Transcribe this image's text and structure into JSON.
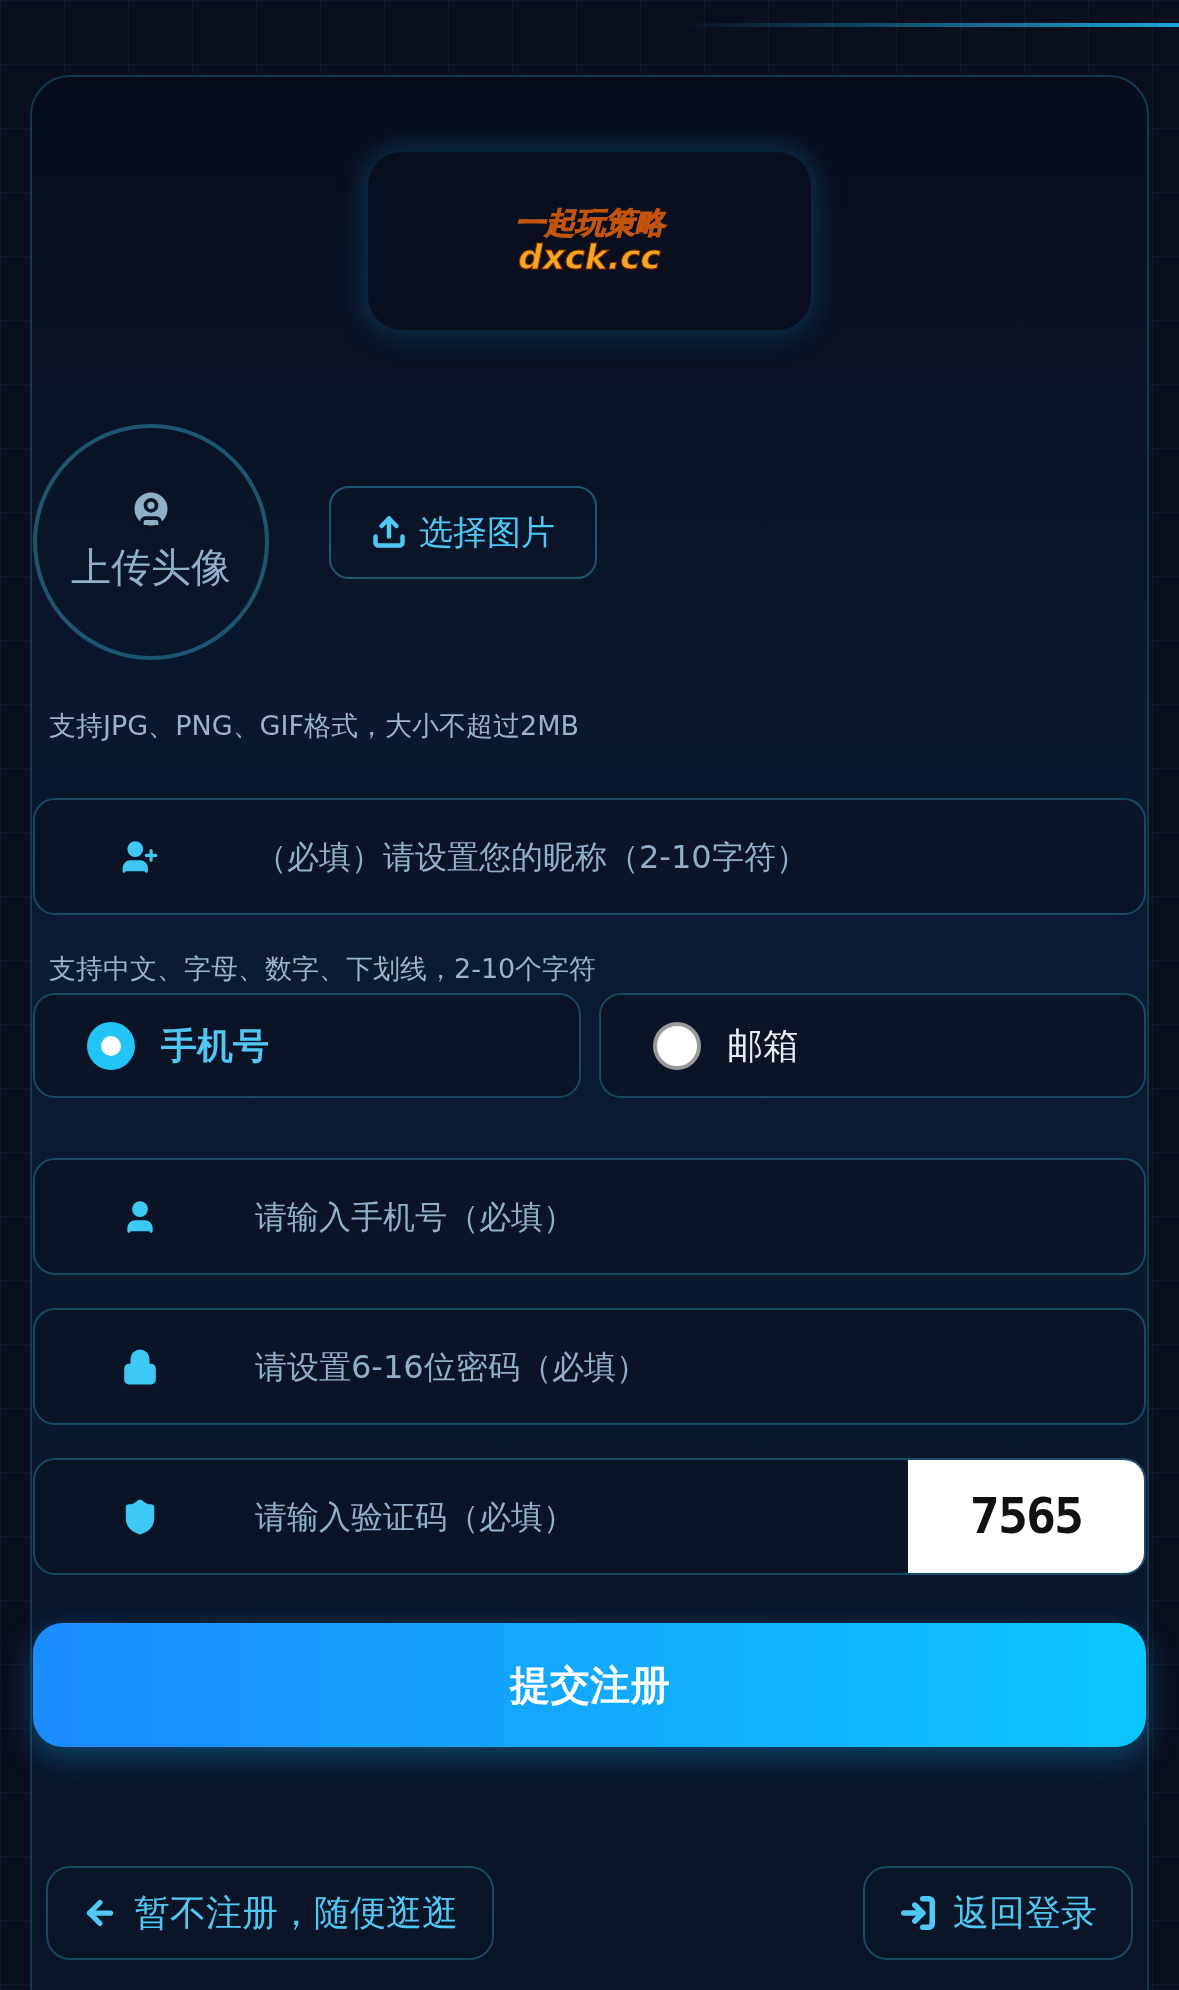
{
  "logo": {
    "title": "一起玩策略",
    "domain": "dxck.cc"
  },
  "avatar": {
    "label": "上传头像"
  },
  "choose_button": {
    "label": "选择图片"
  },
  "avatar_hint": "支持JPG、PNG、GIF格式，大小不超过2MB",
  "nickname": {
    "placeholder": "（必填）请设置您的昵称（2-10字符）",
    "hint": "支持中文、字母、数字、下划线，2-10个字符"
  },
  "contact_types": [
    {
      "label": "手机号",
      "selected": true
    },
    {
      "label": "邮箱",
      "selected": false
    }
  ],
  "fields": [
    {
      "kind": "user",
      "placeholder": "请输入手机号（必填）"
    },
    {
      "kind": "lock",
      "placeholder": "请设置6-16位密码（必填）"
    },
    {
      "kind": "shield",
      "placeholder": "请输入验证码（必填）",
      "captcha": "7565"
    }
  ],
  "submit": {
    "label": "提交注册"
  },
  "footer_buttons": [
    {
      "kind": "back",
      "label": "暂不注册，随便逛逛"
    },
    {
      "kind": "login",
      "label": "返回登录"
    }
  ]
}
